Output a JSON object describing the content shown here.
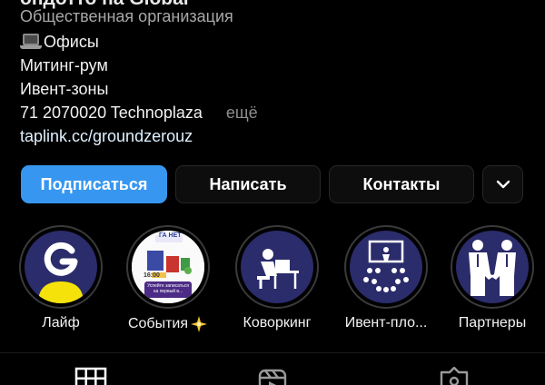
{
  "profile": {
    "name_cut": "ондотто на Global",
    "category": "Общественная организация",
    "bio_line1": "Офисы",
    "bio_line2": "Митинг-рум",
    "bio_line3": "Ивент-зоны",
    "bio_line4": "71 2070020 Technoplaza",
    "more_label": "ещё",
    "link": "taplink.cc/groundzerouz"
  },
  "actions": {
    "follow": "Подписаться",
    "message": "Написать",
    "contacts": "Контакты"
  },
  "highlights": [
    {
      "label": "Лайф"
    },
    {
      "label": "События",
      "poster_title": "ГА НЕТ",
      "poster_date": "16:00",
      "poster_cta": "Успейте записаться на первый в..."
    },
    {
      "label": "Коворкинг"
    },
    {
      "label": "Ивент-пло..."
    },
    {
      "label": "Партнеры"
    }
  ],
  "colors": {
    "background": "#000000",
    "accent": "#3797f0",
    "highlight_bg": "#2b2c6b",
    "logo_yellow": "#f5e20a"
  },
  "icons": {
    "more_dropdown": "chevron-down-icon",
    "bio_emoji": "laptop-icon",
    "events_emoji": "sparkle-star-icon",
    "tab_grid": "grid-icon",
    "tab_reels": "reels-icon",
    "tab_tagged": "tagged-user-icon"
  }
}
